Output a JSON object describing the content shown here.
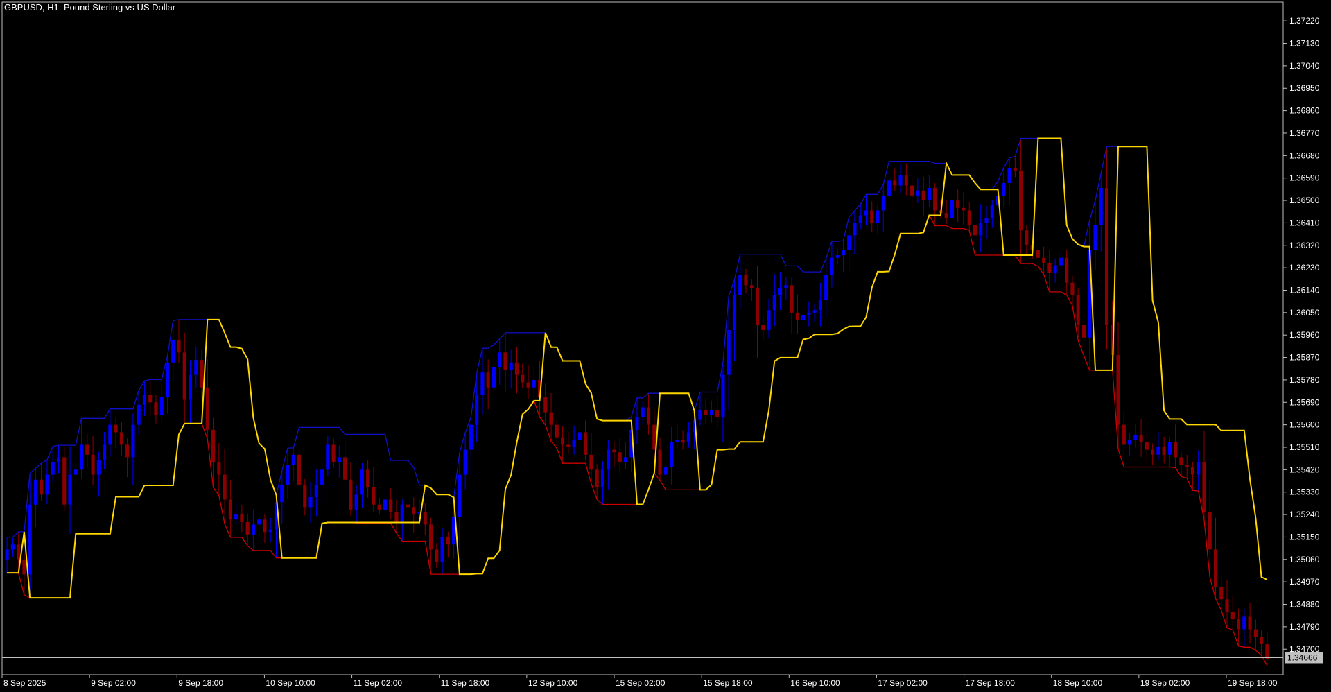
{
  "window": {
    "title": "GBPUSD, H1:  Pound Sterling vs US Dollar"
  },
  "colors": {
    "background": "#000000",
    "frame": "#c0c0c0",
    "bull_candle": "#0000ff",
    "bear_candle": "#8b0000",
    "doji_candle": "#00ff00",
    "upper_band": "#1010c8",
    "lower_band": "#cc0000",
    "trail_line": "#ffd700",
    "price_line": "#c0c0c0",
    "price_label_bg": "#c0c0c0"
  },
  "chart_data": {
    "type": "candlestick",
    "symbol": "GBPUSD",
    "timeframe": "H1",
    "ylim": [
      1.3462,
      1.3729
    ],
    "y_ticks": [
      "1.37220",
      "1.37130",
      "1.37040",
      "1.36950",
      "1.36860",
      "1.36770",
      "1.36680",
      "1.36590",
      "1.36500",
      "1.36410",
      "1.36320",
      "1.36230",
      "1.36140",
      "1.36050",
      "1.35960",
      "1.35870",
      "1.35780",
      "1.35690",
      "1.35600",
      "1.35510",
      "1.35420",
      "1.35330",
      "1.35240",
      "1.35150",
      "1.35060",
      "1.34970",
      "1.34880",
      "1.34790",
      "1.34700"
    ],
    "x_ticks": [
      "8 Sep 2025",
      "9 Sep 02:00",
      "9 Sep 18:00",
      "10 Sep 10:00",
      "11 Sep 02:00",
      "11 Sep 18:00",
      "12 Sep 10:00",
      "15 Sep 02:00",
      "15 Sep 18:00",
      "16 Sep 10:00",
      "17 Sep 02:00",
      "17 Sep 18:00",
      "18 Sep 10:00",
      "19 Sep 02:00",
      "19 Sep 18:00"
    ],
    "current_price": "1.34666",
    "close": [
      1.351,
      1.3512,
      1.3506,
      1.35,
      1.3528,
      1.3538,
      1.3532,
      1.354,
      1.3545,
      1.3547,
      1.3528,
      1.354,
      1.3542,
      1.3552,
      1.3548,
      1.354,
      1.3546,
      1.3552,
      1.356,
      1.3557,
      1.3552,
      1.3547,
      1.356,
      1.3568,
      1.3572,
      1.3569,
      1.3564,
      1.3571,
      1.3585,
      1.3594,
      1.3589,
      1.357,
      1.358,
      1.3586,
      1.3575,
      1.3558,
      1.3545,
      1.354,
      1.353,
      1.3522,
      1.3524,
      1.3521,
      1.3516,
      1.352,
      1.3522,
      1.3517,
      1.3518,
      1.3529,
      1.3536,
      1.3544,
      1.3548,
      1.3536,
      1.3527,
      1.3531,
      1.3536,
      1.3542,
      1.3552,
      1.3545,
      1.3547,
      1.3538,
      1.3526,
      1.3532,
      1.3542,
      1.3535,
      1.3528,
      1.3526,
      1.353,
      1.3525,
      1.3521,
      1.3528,
      1.3527,
      1.3524,
      1.3525,
      1.352,
      1.351,
      1.3505,
      1.3515,
      1.3512,
      1.3523,
      1.354,
      1.355,
      1.356,
      1.3572,
      1.3581,
      1.3575,
      1.3583,
      1.3589,
      1.3582,
      1.3585,
      1.358,
      1.3577,
      1.3575,
      1.3578,
      1.3571,
      1.3565,
      1.356,
      1.3555,
      1.3552,
      1.3551,
      1.3554,
      1.3557,
      1.3548,
      1.3542,
      1.3535,
      1.3542,
      1.355,
      1.3549,
      1.3545,
      1.3547,
      1.3558,
      1.3563,
      1.3567,
      1.356,
      1.355,
      1.354,
      1.3543,
      1.3553,
      1.3554,
      1.3553,
      1.3557,
      1.3562,
      1.3566,
      1.3564,
      1.3566,
      1.3563,
      1.358,
      1.3598,
      1.3612,
      1.362,
      1.3616,
      1.3615,
      1.36,
      1.3598,
      1.3606,
      1.3612,
      1.3615,
      1.3616,
      1.3605,
      1.3602,
      1.3604,
      1.3605,
      1.3606,
      1.361,
      1.362,
      1.3627,
      1.3628,
      1.363,
      1.3636,
      1.3641,
      1.3644,
      1.3646,
      1.3641,
      1.3646,
      1.3652,
      1.3658,
      1.3656,
      1.366,
      1.3656,
      1.3652,
      1.3654,
      1.365,
      1.3655,
      1.3646,
      1.3645,
      1.3643,
      1.365,
      1.3647,
      1.3646,
      1.364,
      1.3636,
      1.3641,
      1.3643,
      1.3648,
      1.3652,
      1.3657,
      1.3663,
      1.3662,
      1.3638,
      1.3632,
      1.363,
      1.3627,
      1.3625,
      1.3621,
      1.3624,
      1.3627,
      1.3617,
      1.3612,
      1.36,
      1.3595,
      1.363,
      1.364,
      1.3655,
      1.36,
      1.3588,
      1.356,
      1.3552,
      1.3554,
      1.3556,
      1.3553,
      1.355,
      1.3548,
      1.3551,
      1.3548,
      1.3553,
      1.3547,
      1.3544,
      1.3543,
      1.354,
      1.3545,
      1.3525,
      1.351,
      1.3495,
      1.349,
      1.3485,
      1.3482,
      1.3478,
      1.3483,
      1.3478,
      1.3475,
      1.3472,
      1.3466
    ]
  }
}
